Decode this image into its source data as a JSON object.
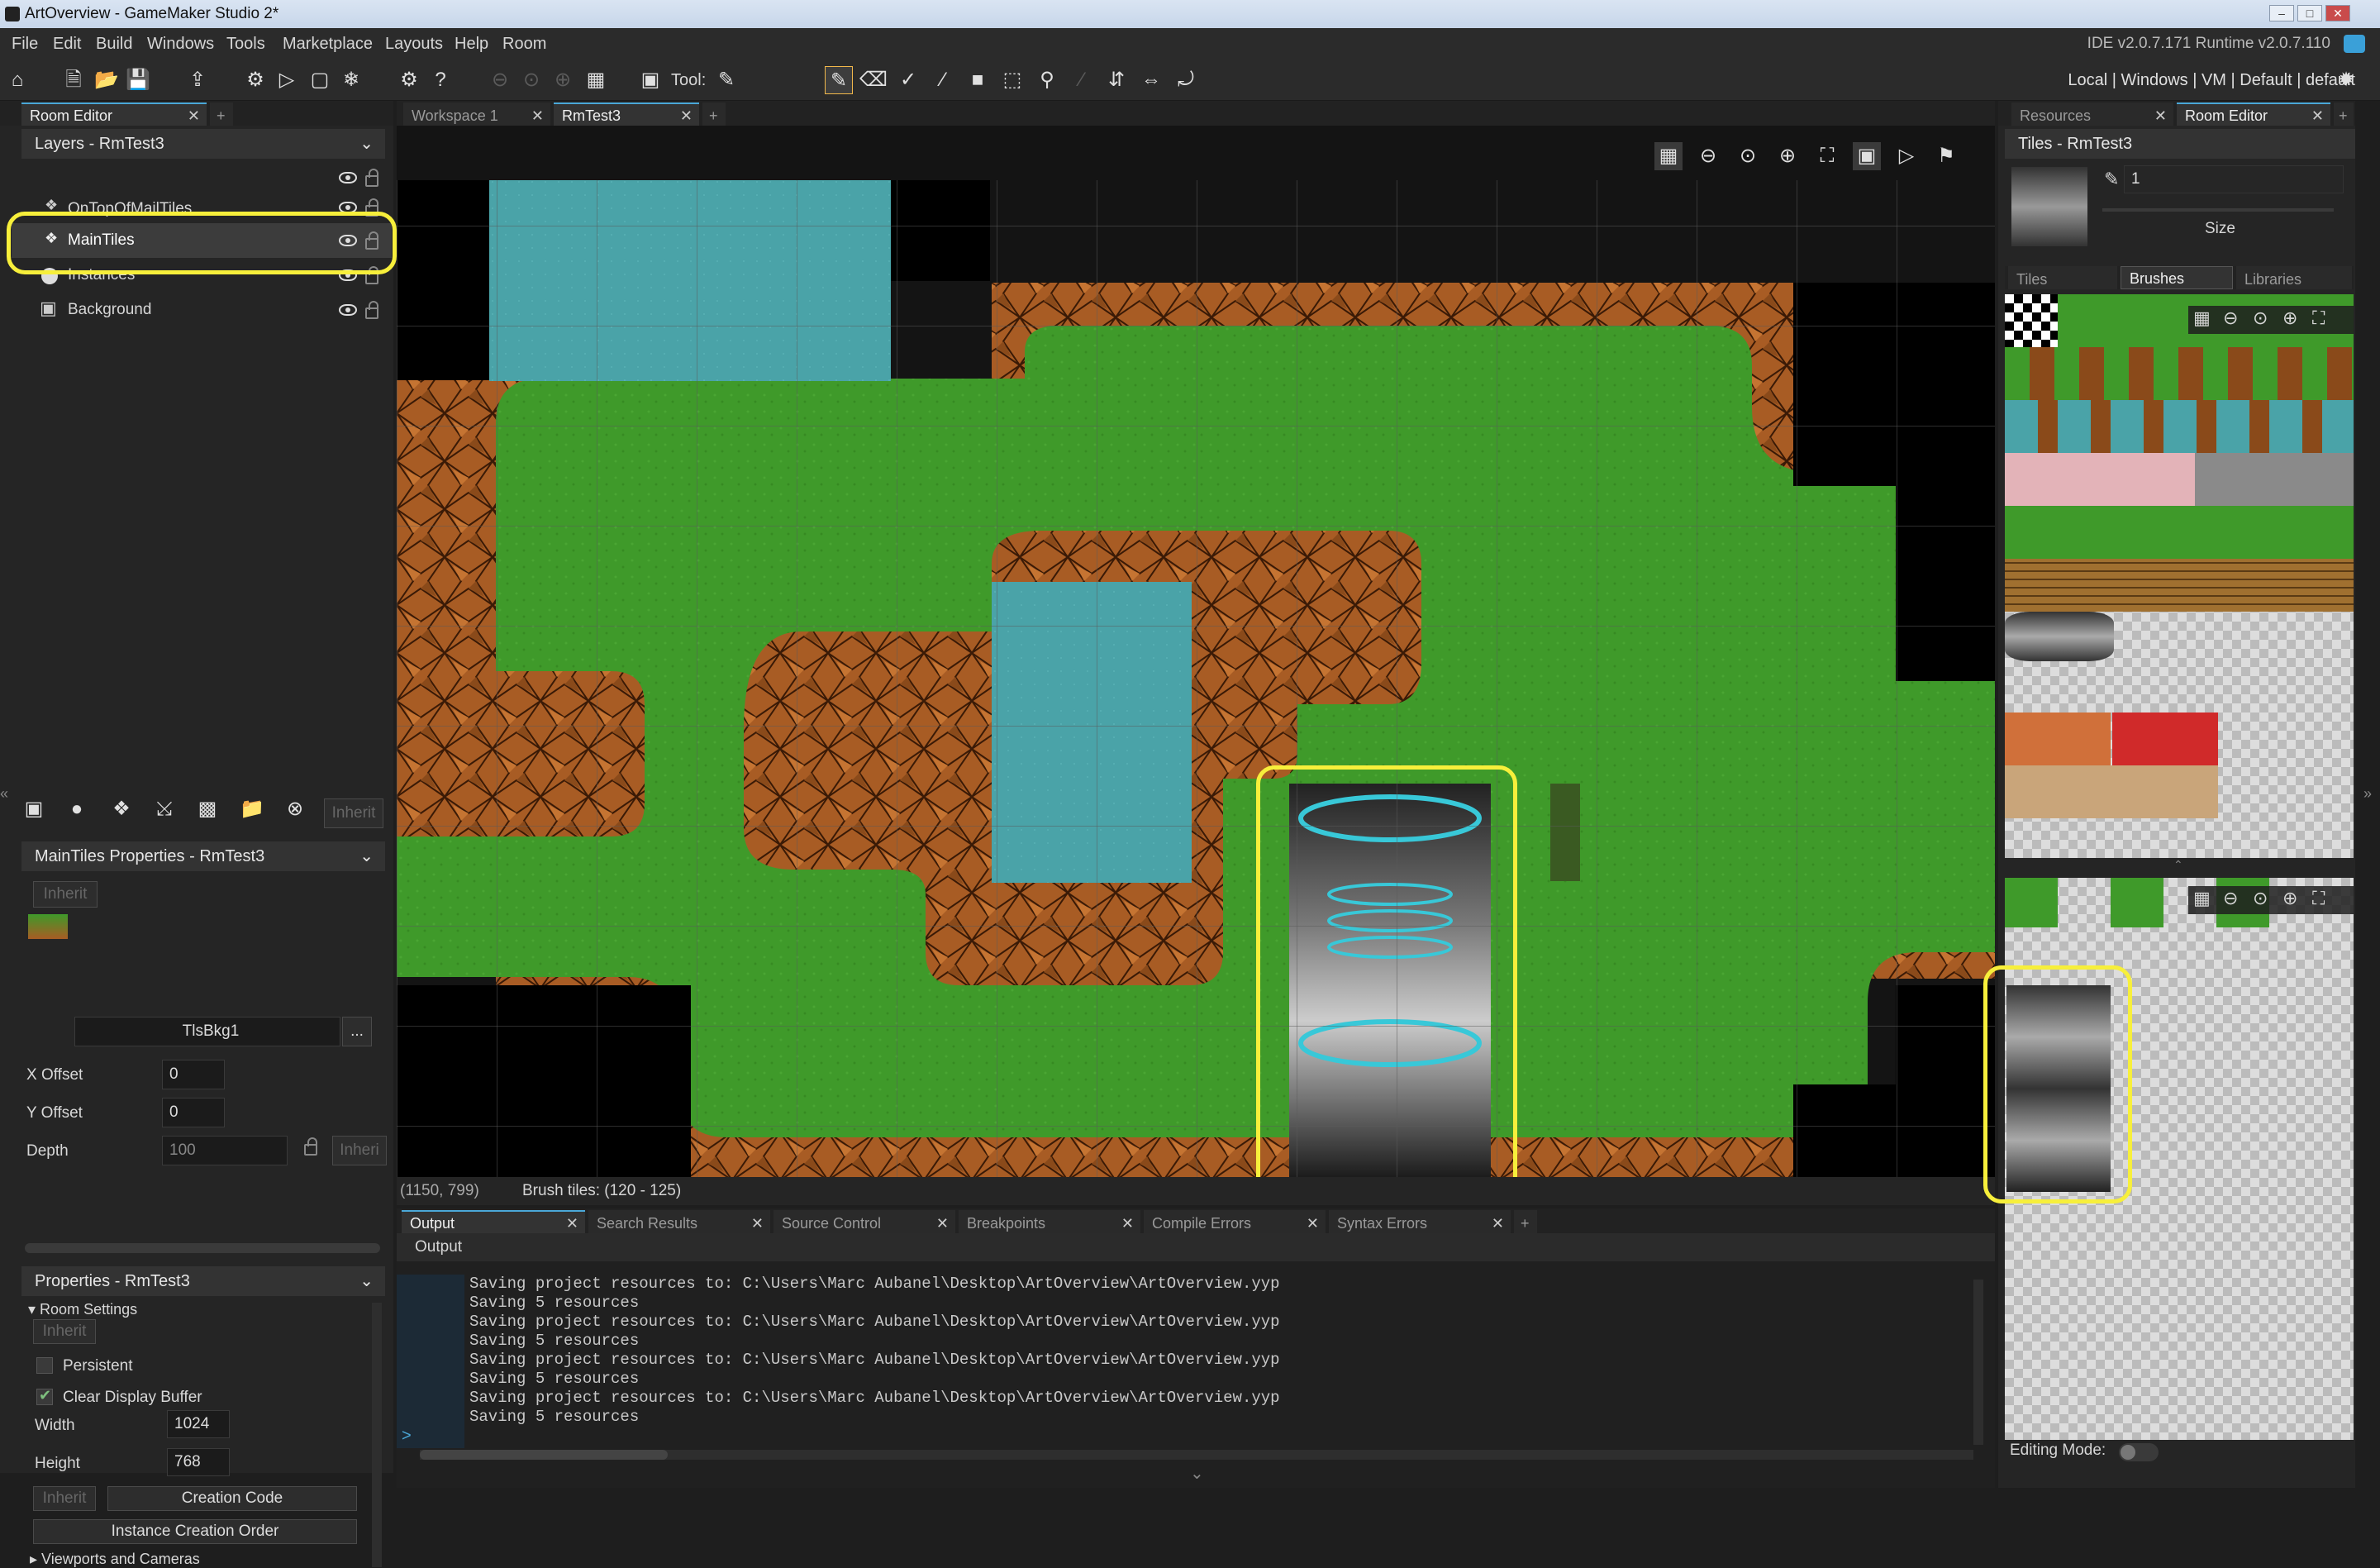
{
  "window": {
    "title": "ArtOverview - GameMaker Studio 2*"
  },
  "menu": {
    "items": [
      "File",
      "Edit",
      "Build",
      "Windows",
      "Tools",
      "Marketplace",
      "Layouts",
      "Help",
      "Room"
    ],
    "version": "IDE v2.0.7.171 Runtime v2.0.7.110"
  },
  "toolbar": {
    "tool_label": "Tool:",
    "target": "Local | Windows | VM | Default | default"
  },
  "left": {
    "tab": "Room Editor",
    "layers_header": "Layers - RmTest3",
    "layers": [
      {
        "name": "OnTopOfMailTiles",
        "icon": "tile-layer-icon"
      },
      {
        "name": "MainTiles",
        "icon": "tile-layer-icon"
      },
      {
        "name": "Instances",
        "icon": "instance-layer-icon"
      },
      {
        "name": "Background",
        "icon": "background-layer-icon"
      }
    ],
    "inherit_label": "Inherit",
    "layer_props_header": "MainTiles Properties - RmTest3",
    "tileset_name": "TlsBkg1",
    "tileset_more": "...",
    "x_offset_label": "X Offset",
    "x_offset": "0",
    "y_offset_label": "Y Offset",
    "y_offset": "0",
    "depth_label": "Depth",
    "depth": "100",
    "depth_inherit": "Inheri",
    "room_props_header": "Properties - RmTest3",
    "room_settings": "Room Settings",
    "persistent_label": "Persistent",
    "clear_display_label": "Clear Display Buffer",
    "width_label": "Width",
    "width": "1024",
    "height_label": "Height",
    "height": "768",
    "creation_code": "Creation Code",
    "instance_creation_order": "Instance Creation Order",
    "viewports": "Viewports and Cameras"
  },
  "center": {
    "tabs": [
      "Workspace 1",
      "RmTest3"
    ],
    "status_coords": "(1150, 799)",
    "status_brush": "Brush tiles: (120 - 125)"
  },
  "output": {
    "tabs": [
      "Output",
      "Search Results",
      "Source Control",
      "Breakpoints",
      "Compile Errors",
      "Syntax Errors"
    ],
    "header": "Output",
    "lines": [
      "Saving project resources to: C:\\Users\\Marc Aubanel\\Desktop\\ArtOverview\\ArtOverview.yyp",
      "Saving 5 resources",
      "Saving project resources to: C:\\Users\\Marc Aubanel\\Desktop\\ArtOverview\\ArtOverview.yyp",
      "Saving 5 resources",
      "Saving project resources to: C:\\Users\\Marc Aubanel\\Desktop\\ArtOverview\\ArtOverview.yyp",
      "Saving 5 resources",
      "Saving project resources to: C:\\Users\\Marc Aubanel\\Desktop\\ArtOverview\\ArtOverview.yyp",
      "Saving 5 resources"
    ],
    "prompt": ">"
  },
  "right": {
    "tabs": [
      "Resources",
      "Room Editor"
    ],
    "tiles_header": "Tiles - RmTest3",
    "brush_size": "1",
    "size_label": "Size",
    "subtabs": [
      "Tiles",
      "Brushes",
      "Libraries"
    ],
    "editing_mode": "Editing Mode:"
  },
  "colors": {
    "accent": "#4aa8d8",
    "highlight": "#f7ef3b",
    "grass": "#3f9a2a",
    "water": "#4aa3a8"
  }
}
